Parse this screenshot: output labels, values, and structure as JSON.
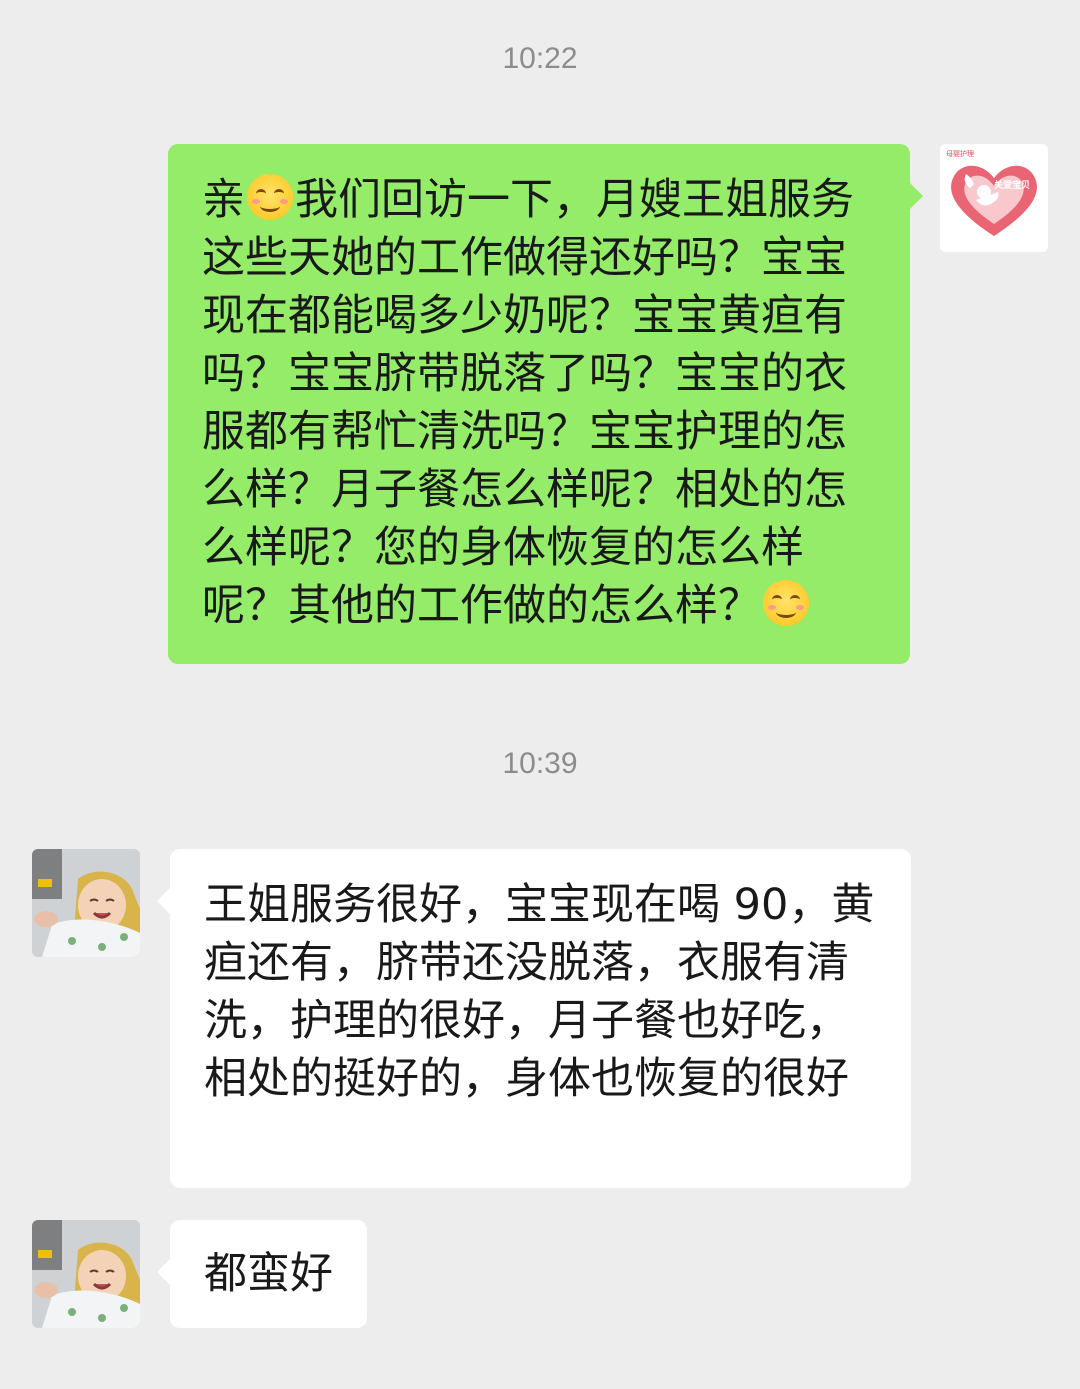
{
  "chat": {
    "timestamp_1": "10:22",
    "timestamp_2": "10:39",
    "msg1": {
      "part_a": "亲",
      "part_b": "我们回访一下，月嫂王姐服务这些天她的工作做得还好吗？宝宝现在都能喝多少奶呢？宝宝黄疸有吗？宝宝脐带脱落了吗？宝宝的衣服都有帮忙清洗吗？宝宝护理的怎么样？月子餐怎么样呢？相处的怎么样呢？您的身体恢复的怎么样呢？其他的工作做的怎么样？"
    },
    "msg2": "王姐服务很好，宝宝现在喝 90，黄疸还有，脐带还没脱落，衣服有清洗，护理的很好，月子餐也好吃，相处的挺好的，身体也恢复的很好",
    "msg3": "都蛮好"
  },
  "avatars": {
    "self_logo_caption": "母婴护理",
    "self_logo_text": "关爱宝贝",
    "self_icon": "heart-cupid-logo",
    "contact_icon": "baby-photo"
  },
  "colors": {
    "background": "#ededed",
    "sent_bubble": "#95ec69",
    "received_bubble": "#ffffff",
    "timestamp": "#8c8c8c",
    "logo_heart": "#e64a5a"
  },
  "icons": {
    "emoji": "smiling-face-emoji"
  }
}
